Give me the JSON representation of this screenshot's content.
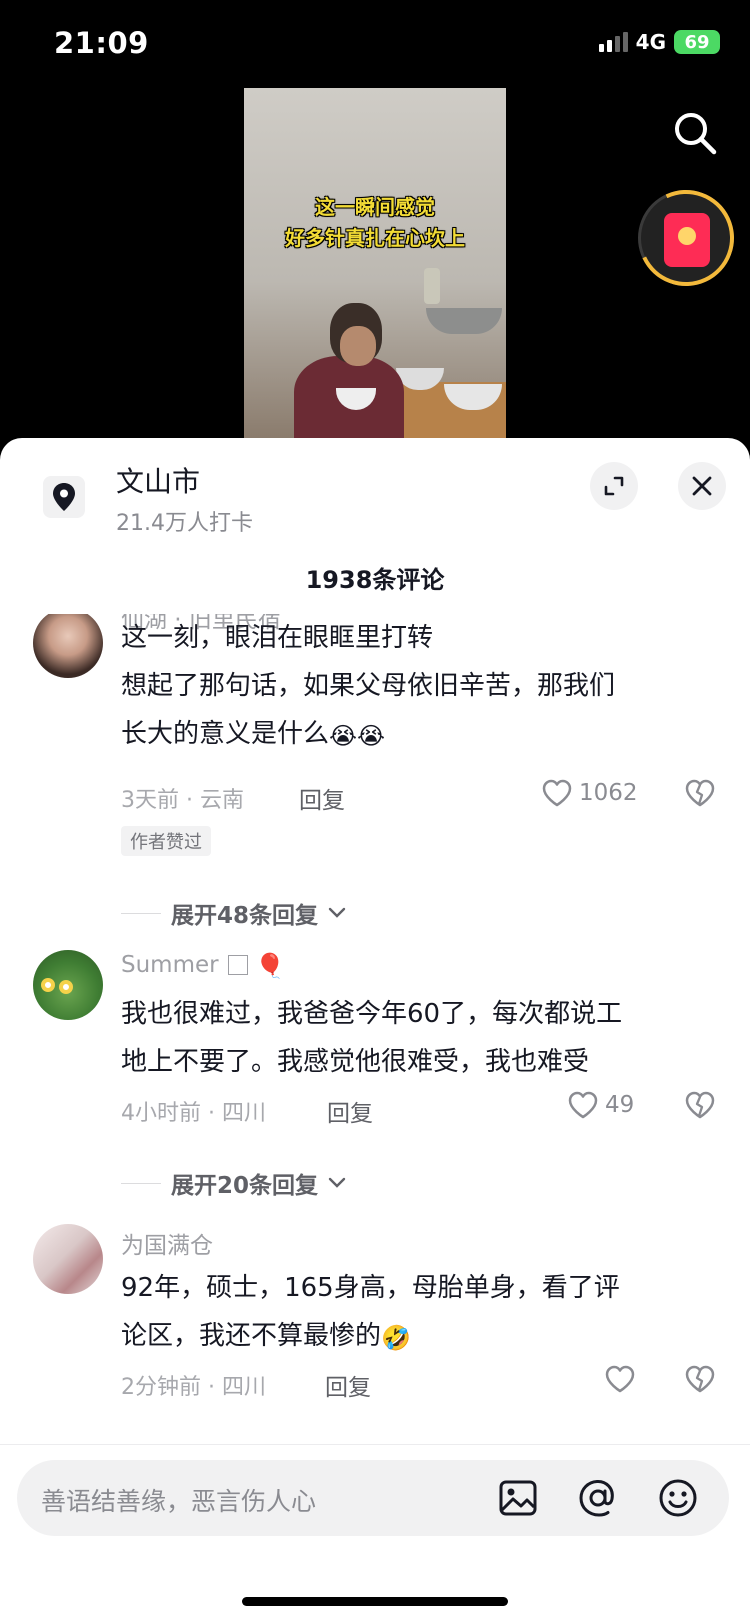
{
  "status_bar": {
    "time": "21:09",
    "network": "4G",
    "battery": "69"
  },
  "video": {
    "caption_line1": "这一瞬间感觉",
    "caption_line2": "好多针真扎在心坎上"
  },
  "icons": {
    "search": "search-icon",
    "red_packet": "red-packet-icon",
    "location": "location-pin-icon",
    "expand": "expand-icon",
    "close": "close-icon",
    "like": "heart-icon",
    "dislike": "broken-heart-icon",
    "image": "image-icon",
    "mention": "at-icon",
    "emoji": "smiley-icon"
  },
  "panel": {
    "location_name": "文山市",
    "checkins": "21.4万人打卡",
    "comment_count": "1938条评论"
  },
  "comments": [
    {
      "author": "仙湖 · 旧里民宿",
      "line1": "这一刻，眼泪在眼眶里打转",
      "line2": "想起了那句话，如果父母依旧辛苦，那我们",
      "line3": "长大的意义是什么",
      "emoji": "😭😭",
      "meta": "3天前 · 云南",
      "reply": "回复",
      "likes": "1062",
      "badge": "作者赞过",
      "expand": "展开48条回复"
    },
    {
      "author": "Summer",
      "author_emoji": "🎈",
      "line1": "我也很难过，我爸爸今年60了，每次都说工",
      "line2": "地上不要了。我感觉他很难受，我也难受",
      "meta": "4小时前 · 四川",
      "reply": "回复",
      "likes": "49",
      "expand": "展开20条回复"
    },
    {
      "author": "为国满仓",
      "line1": "92年，硕士，165身高，母胎单身，看了评",
      "line2": "论区，我还不算最惨的",
      "emoji": "🤣",
      "meta": "2分钟前 · 四川",
      "reply": "回复",
      "likes": ""
    }
  ],
  "input": {
    "placeholder": "善语结善缘，恶言伤人心"
  },
  "colors": {
    "accent_red": "#fe2c55",
    "caption_yellow": "#f3dc35",
    "battery_green": "#4cd964"
  }
}
